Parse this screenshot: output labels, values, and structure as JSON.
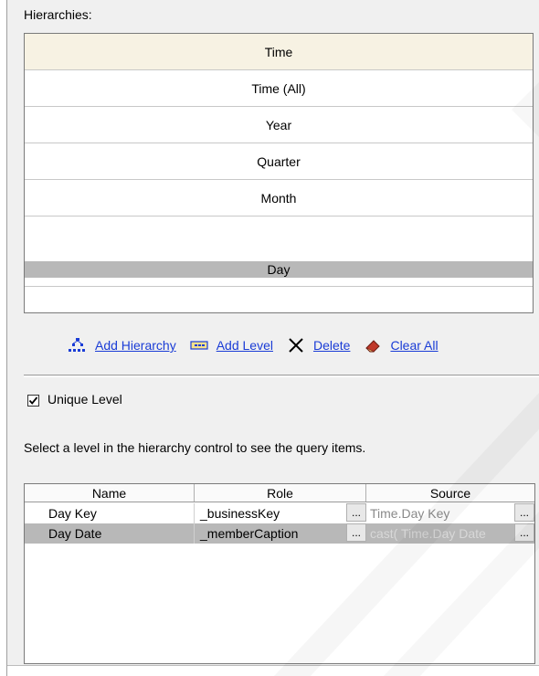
{
  "hierarchies": {
    "label": "Hierarchies:",
    "header": "Time",
    "levels": [
      "Time (All)",
      "Year",
      "Quarter",
      "Month"
    ],
    "selected_level": "Day"
  },
  "toolbar": {
    "add_hierarchy": "Add Hierarchy",
    "add_level": "Add Level",
    "delete": "Delete",
    "clear_all": "Clear All"
  },
  "options": {
    "unique_level_label": "Unique Level",
    "unique_level_checked": true
  },
  "hint": "Select a level in the hierarchy control to see the query items.",
  "query_items": {
    "columns": [
      "Name",
      "Role",
      "Source"
    ],
    "rows": [
      {
        "name": "Day Key",
        "role": "_businessKey",
        "source": "Time.Day Key",
        "selected": false
      },
      {
        "name": "Day Date",
        "role": "_memberCaption",
        "source": "cast( Time.Day Date",
        "selected": true
      }
    ],
    "ellipsis": "..."
  },
  "colors": {
    "link": "#1a3cd6",
    "selection": "#b8b8b8",
    "header_bg": "#f7f2e3"
  }
}
